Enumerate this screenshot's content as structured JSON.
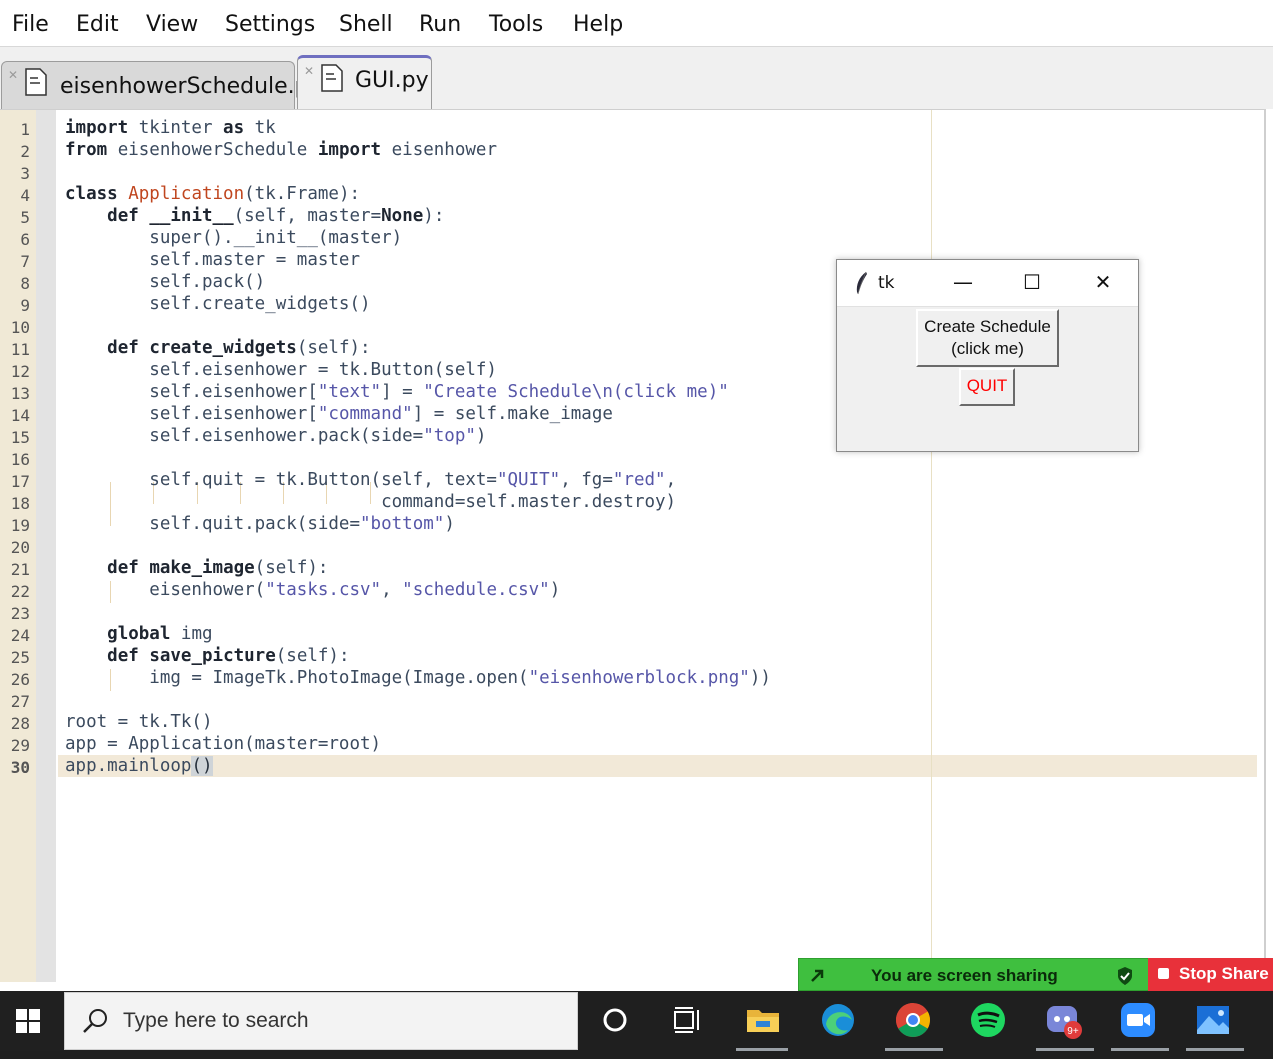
{
  "menu": [
    "File",
    "Edit",
    "View",
    "Settings",
    "Shell",
    "Run",
    "Tools",
    "Help"
  ],
  "tabs": [
    {
      "label": "eisenhowerSchedule.py",
      "active": false
    },
    {
      "label": "GUI.py",
      "active": true
    }
  ],
  "line_numbers": [
    "1",
    "2",
    "3",
    "4",
    "5",
    "6",
    "7",
    "8",
    "9",
    "10",
    "11",
    "12",
    "13",
    "14",
    "15",
    "16",
    "17",
    "18",
    "19",
    "20",
    "21",
    "22",
    "23",
    "24",
    "25",
    "26",
    "27",
    "28",
    "29",
    "30"
  ],
  "code": {
    "l1_kw1": "import",
    "l1_rest": " tkinter ",
    "l1_kw2": "as",
    "l1_rest2": " tk",
    "l2_kw1": "from",
    "l2_rest": " eisenhowerSchedule ",
    "l2_kw2": "import",
    "l2_rest2": " eisenhower",
    "l4_kw": "class",
    "l4_cls": "Application",
    "l4_rest": "(tk.Frame):",
    "l5_indent": "    ",
    "l5_kw": "def",
    "l5_fn": "__init__",
    "l5_rest": "(self, master=",
    "l5_none": "None",
    "l5_end": "):",
    "l6": "        super().__init__(master)",
    "l7": "        self.master = master",
    "l8": "        self.pack()",
    "l9": "        self.create_widgets()",
    "l11_indent": "    ",
    "l11_kw": "def",
    "l11_fn": "create_widgets",
    "l11_rest": "(self):",
    "l12": "        self.eisenhower = tk.Button(self)",
    "l13_a": "        self.eisenhower[",
    "l13_s1": "\"text\"",
    "l13_b": "] = ",
    "l13_s2": "\"Create Schedule\\n(click me)\"",
    "l14_a": "        self.eisenhower[",
    "l14_s1": "\"command\"",
    "l14_b": "] = self.make_image",
    "l15_a": "        self.eisenhower.pack(side=",
    "l15_s": "\"top\"",
    "l15_b": ")",
    "l17_a": "        self.quit = tk.Button(self, text=",
    "l17_s1": "\"QUIT\"",
    "l17_b": ", fg=",
    "l17_s2": "\"red\"",
    "l17_c": ",",
    "l18": "                              command=self.master.destroy)",
    "l19_a": "        self.quit.pack(side=",
    "l19_s": "\"bottom\"",
    "l19_b": ")",
    "l21_indent": "    ",
    "l21_kw": "def",
    "l21_fn": "make_image",
    "l21_rest": "(self):",
    "l22_a": "        eisenhower(",
    "l22_s1": "\"tasks.csv\"",
    "l22_b": ", ",
    "l22_s2": "\"schedule.csv\"",
    "l22_c": ")",
    "l24_indent": "    ",
    "l24_kw": "global",
    "l24_rest": " img",
    "l25_indent": "    ",
    "l25_kw": "def",
    "l25_fn": "save_picture",
    "l25_rest": "(self):",
    "l26_a": "        img = ImageTk.PhotoImage(Image.open(",
    "l26_s": "\"eisenhowerblock.png\"",
    "l26_b": "))",
    "l28": "root = tk.Tk()",
    "l29": "app = Application(master=root)",
    "l30_a": "app.mainloop",
    "l30_b": "()"
  },
  "tk_window": {
    "title": "tk",
    "minimize": "—",
    "maximize": "☐",
    "close": "✕",
    "button1_line1": "Create Schedule",
    "button1_line2": "(click me)",
    "button2": "QUIT",
    "quit_color": "#ff0000"
  },
  "share_bar": {
    "message": "You are screen sharing",
    "stop_label": "Stop Share"
  },
  "taskbar": {
    "search_placeholder": "Type here to search",
    "badge": "9+"
  }
}
